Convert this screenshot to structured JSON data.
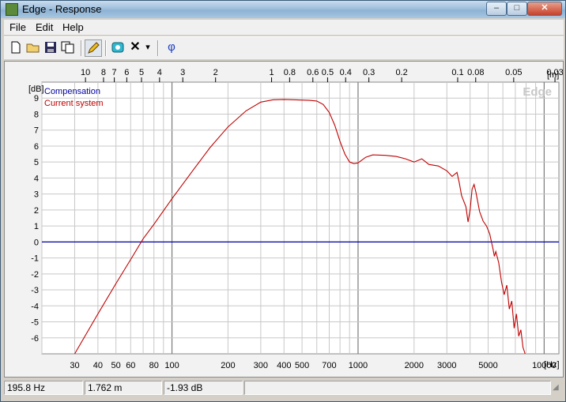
{
  "window": {
    "title": "Edge - Response"
  },
  "titlebar_buttons": {
    "minimize": "–",
    "maximize": "□",
    "close": "✕"
  },
  "menu": [
    {
      "label": "File"
    },
    {
      "label": "Edit"
    },
    {
      "label": "Help"
    }
  ],
  "toolbar": {
    "icons": [
      "new-file-icon",
      "open-folder-icon",
      "save-icon",
      "copy-icon",
      "pen-icon",
      "speaker-icon",
      "delete-icon",
      "dropdown-arrow-icon",
      "phase-icon"
    ],
    "phase_label": "φ",
    "delete_label": "✕",
    "dropdown_label": "▾"
  },
  "chart_data": {
    "type": "line",
    "watermark": "Edge",
    "ylabel": "[dB]",
    "xlabel": "[Hz]",
    "top_axis_label": "[m]",
    "x_scale": "log",
    "xlim": [
      20,
      12000
    ],
    "ylim": [
      -7,
      10
    ],
    "y_ticks": [
      9,
      8,
      7,
      6,
      5,
      4,
      3,
      2,
      1,
      0,
      -1,
      -2,
      -3,
      -4,
      -5,
      -6
    ],
    "x_ticks": [
      {
        "value": 30,
        "label": "30"
      },
      {
        "value": 40,
        "label": "40"
      },
      {
        "value": 50,
        "label": "50"
      },
      {
        "value": 60,
        "label": "60"
      },
      {
        "value": 80,
        "label": "80"
      },
      {
        "value": 100,
        "label": "100"
      },
      {
        "value": 200,
        "label": "200"
      },
      {
        "value": 300,
        "label": "300"
      },
      {
        "value": 400,
        "label": "400"
      },
      {
        "value": 500,
        "label": "500"
      },
      {
        "value": 700,
        "label": "700"
      },
      {
        "value": 1000,
        "label": "1000"
      },
      {
        "value": 2000,
        "label": "2000"
      },
      {
        "value": 3000,
        "label": "3000"
      },
      {
        "value": 5000,
        "label": "5000"
      },
      {
        "value": 10000,
        "label": "10000"
      }
    ],
    "top_ticks": [
      {
        "value": 10,
        "label": "10"
      },
      {
        "value": 8,
        "label": "8"
      },
      {
        "value": 7,
        "label": "7"
      },
      {
        "value": 6,
        "label": "6"
      },
      {
        "value": 5,
        "label": "5"
      },
      {
        "value": 4,
        "label": "4"
      },
      {
        "value": 3,
        "label": "3"
      },
      {
        "value": 2,
        "label": "2"
      },
      {
        "value": 1,
        "label": "1"
      },
      {
        "value": 0.8,
        "label": "0.8"
      },
      {
        "value": 0.6,
        "label": "0.6"
      },
      {
        "value": 0.5,
        "label": "0.5"
      },
      {
        "value": 0.4,
        "label": "0.4"
      },
      {
        "value": 0.3,
        "label": "0.3"
      },
      {
        "value": 0.2,
        "label": "0.2"
      },
      {
        "value": 0.1,
        "label": "0.1"
      },
      {
        "value": 0.08,
        "label": "0.08"
      },
      {
        "value": 0.05,
        "label": "0.05"
      },
      {
        "value": 0.03,
        "label": "0.03"
      }
    ],
    "speed_of_sound": 343,
    "series": [
      {
        "name": "Compensation",
        "color": "#0000a0",
        "x": [
          20,
          12000
        ],
        "y": [
          0,
          0
        ]
      },
      {
        "name": "Current system",
        "color": "#c00000",
        "x": [
          30,
          40,
          50,
          60,
          70,
          80,
          100,
          130,
          160,
          200,
          250,
          300,
          350,
          400,
          450,
          500,
          550,
          600,
          650,
          700,
          750,
          800,
          850,
          900,
          950,
          1000,
          1100,
          1200,
          1400,
          1600,
          1800,
          2000,
          2200,
          2400,
          2700,
          3000,
          3200,
          3400,
          3500,
          3600,
          3800,
          3900,
          4000,
          4100,
          4200,
          4300,
          4500,
          4700,
          4900,
          5100,
          5300,
          5400,
          5500,
          5700,
          5900,
          6100,
          6300,
          6500,
          6700,
          6900,
          7100,
          7300,
          7500,
          7700,
          7900
        ],
        "y": [
          -7.0,
          -4.5,
          -2.6,
          -1.1,
          0.2,
          1.1,
          2.7,
          4.5,
          5.9,
          7.2,
          8.2,
          8.75,
          8.9,
          8.92,
          8.9,
          8.88,
          8.86,
          8.82,
          8.6,
          8.1,
          7.3,
          6.3,
          5.5,
          5.0,
          4.9,
          4.95,
          5.3,
          5.45,
          5.42,
          5.35,
          5.2,
          5.0,
          5.2,
          4.85,
          4.75,
          4.45,
          4.1,
          4.35,
          3.7,
          2.9,
          2.2,
          1.25,
          2.0,
          3.3,
          3.6,
          3.1,
          1.9,
          1.3,
          1.0,
          0.5,
          -0.4,
          -0.9,
          -0.6,
          -1.3,
          -2.5,
          -3.3,
          -2.7,
          -4.2,
          -3.7,
          -5.4,
          -4.5,
          -5.9,
          -5.5,
          -6.6,
          -7.0
        ]
      }
    ]
  },
  "status": {
    "frequency": "195.8 Hz",
    "distance": "1.762 m",
    "level": "-1.93 dB",
    "extra": ""
  }
}
